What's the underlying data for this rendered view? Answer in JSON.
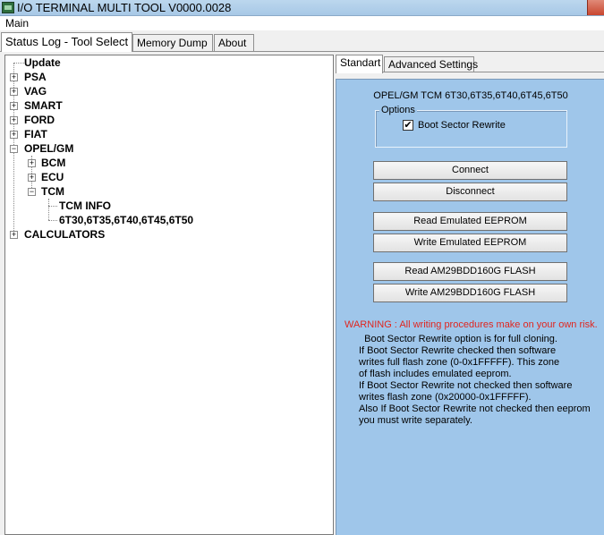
{
  "window": {
    "title": "I/O TERMINAL MULTI TOOL V0000.0028"
  },
  "menu": {
    "main": "Main"
  },
  "tabs": [
    "Status Log - Tool Select",
    "Memory Dump",
    "About"
  ],
  "tree": {
    "update": "Update",
    "psa": "PSA",
    "vag": "VAG",
    "smart": "SMART",
    "ford": "FORD",
    "fiat": "FIAT",
    "opel": "OPEL/GM",
    "bcm": "BCM",
    "ecu": "ECU",
    "tcm": "TCM",
    "tcm_info": "TCM INFO",
    "tcm_models": "6T30,6T35,6T40,6T45,6T50",
    "calculators": "CALCULATORS"
  },
  "right_tabs": [
    "Standart",
    "Advanced Settings"
  ],
  "panel": {
    "heading": "OPEL/GM TCM 6T30,6T35,6T40,6T45,6T50",
    "options_label": "Options",
    "checkbox_label": "Boot Sector Rewrite",
    "checkbox_mark": "✔",
    "buttons": {
      "connect": "Connect",
      "disconnect": "Disconnect",
      "read_eeprom": "Read Emulated EEPROM",
      "write_eeprom": "Write Emulated EEPROM",
      "read_flash": "Read AM29BDD160G  FLASH",
      "write_flash": "Write AM29BDD160G  FLASH"
    },
    "warning": "WARNING : All writing procedures make on your own risk.",
    "info_lines": [
      "  Boot Sector Rewrite option is for full cloning.",
      "If Boot Sector Rewrite checked then software",
      "writes full flash zone (0-0x1FFFFF). This zone",
      "of flash includes emulated eeprom.",
      "If Boot Sector Rewrite not checked then software",
      "writes flash zone (0x20000-0x1FFFFF).",
      "Also If Boot Sector Rewrite not checked then eeprom",
      "you must write separately."
    ]
  },
  "colors": {
    "panel_bg": "#9fc6ea",
    "warning": "#e0261f"
  }
}
